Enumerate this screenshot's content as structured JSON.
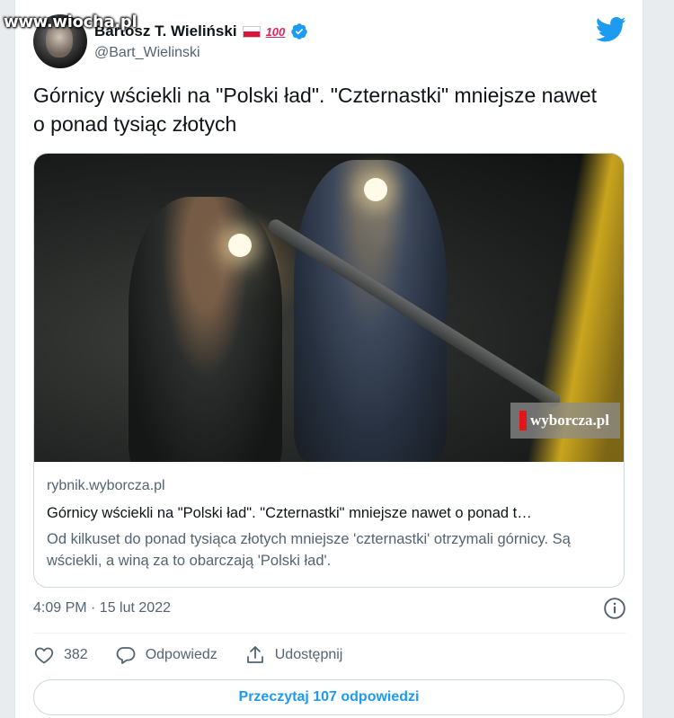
{
  "watermark": "www.wiocha.pl",
  "author": {
    "display_name": "Bartosz T. Wieliński",
    "handle": "@Bart_Wielinski",
    "badge_text": "100"
  },
  "tweet": {
    "text": "Górnicy wściekli na \"Polski ład\". \"Czternastki\" mniejsze nawet o ponad tysiąc złotych"
  },
  "link_card": {
    "image_badge": "wyborcza.pl",
    "domain": "rybnik.wyborcza.pl",
    "title": "Górnicy wściekli na \"Polski ład\". \"Czternastki\" mniejsze nawet o ponad t…",
    "description": "Od kilkuset do ponad tysiąca złotych mniejsze 'czternastki' otrzymali górnicy. Są wściekli, a winą za to obarczają 'Polski ład'."
  },
  "timestamp": "4:09 PM · 15 lut 2022",
  "actions": {
    "likes": "382",
    "reply_label": "Odpowiedz",
    "share_label": "Udostępnij"
  },
  "read_replies_label": "Przeczytaj 107 odpowiedzi",
  "colors": {
    "accent": "#1d9bf0",
    "text": "#0f1419",
    "secondary": "#536471",
    "border": "#cfd9de"
  }
}
